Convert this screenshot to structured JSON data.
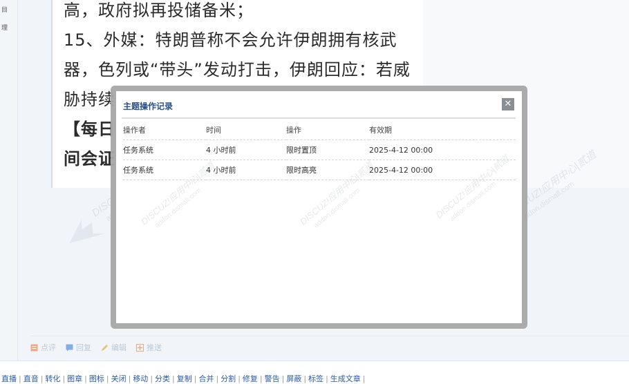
{
  "left_strip": {
    "text_a": "目",
    "text_b": "理"
  },
  "post": {
    "line1": "高，政府拟再投储备米；",
    "line2": "15、外媒：特朗普称不会允许伊朗拥有核武",
    "line3": "器，色列或“带头”发动打击，伊朗回应：若威",
    "line4": "胁持续",
    "line5": "【每日",
    "line6": "间会证"
  },
  "watermark": {
    "line1": "DISCUZ!应用中心|贰道",
    "line2": "addon.dismall.com"
  },
  "modal": {
    "title": "主题操作记录",
    "close_glyph": "✕",
    "headers": [
      "操作者",
      "时间",
      "操作",
      "有效期"
    ],
    "rows": [
      [
        "任务系统",
        "4 小时前",
        "限时置顶",
        "2025-4-12 00:00"
      ],
      [
        "任务系统",
        "4 小时前",
        "限时高亮",
        "2025-4-12 00:00"
      ]
    ]
  },
  "actions": [
    {
      "label": "点评",
      "icon": "comment-icon",
      "color": "#e8773a"
    },
    {
      "label": "回复",
      "icon": "reply-icon",
      "color": "#3b7fd1"
    },
    {
      "label": "编辑",
      "icon": "pencil-icon",
      "color": "#e0a52a"
    },
    {
      "label": "推送",
      "icon": "push-icon",
      "color": "#e8773a"
    }
  ],
  "bottom_links": [
    "直播",
    "直音",
    "转化",
    "图章",
    "图标",
    "关闭",
    "移动",
    "分类",
    "复制",
    "合并",
    "分割",
    "修复",
    "警告",
    "屏蔽",
    "标签",
    "生成文章"
  ]
}
